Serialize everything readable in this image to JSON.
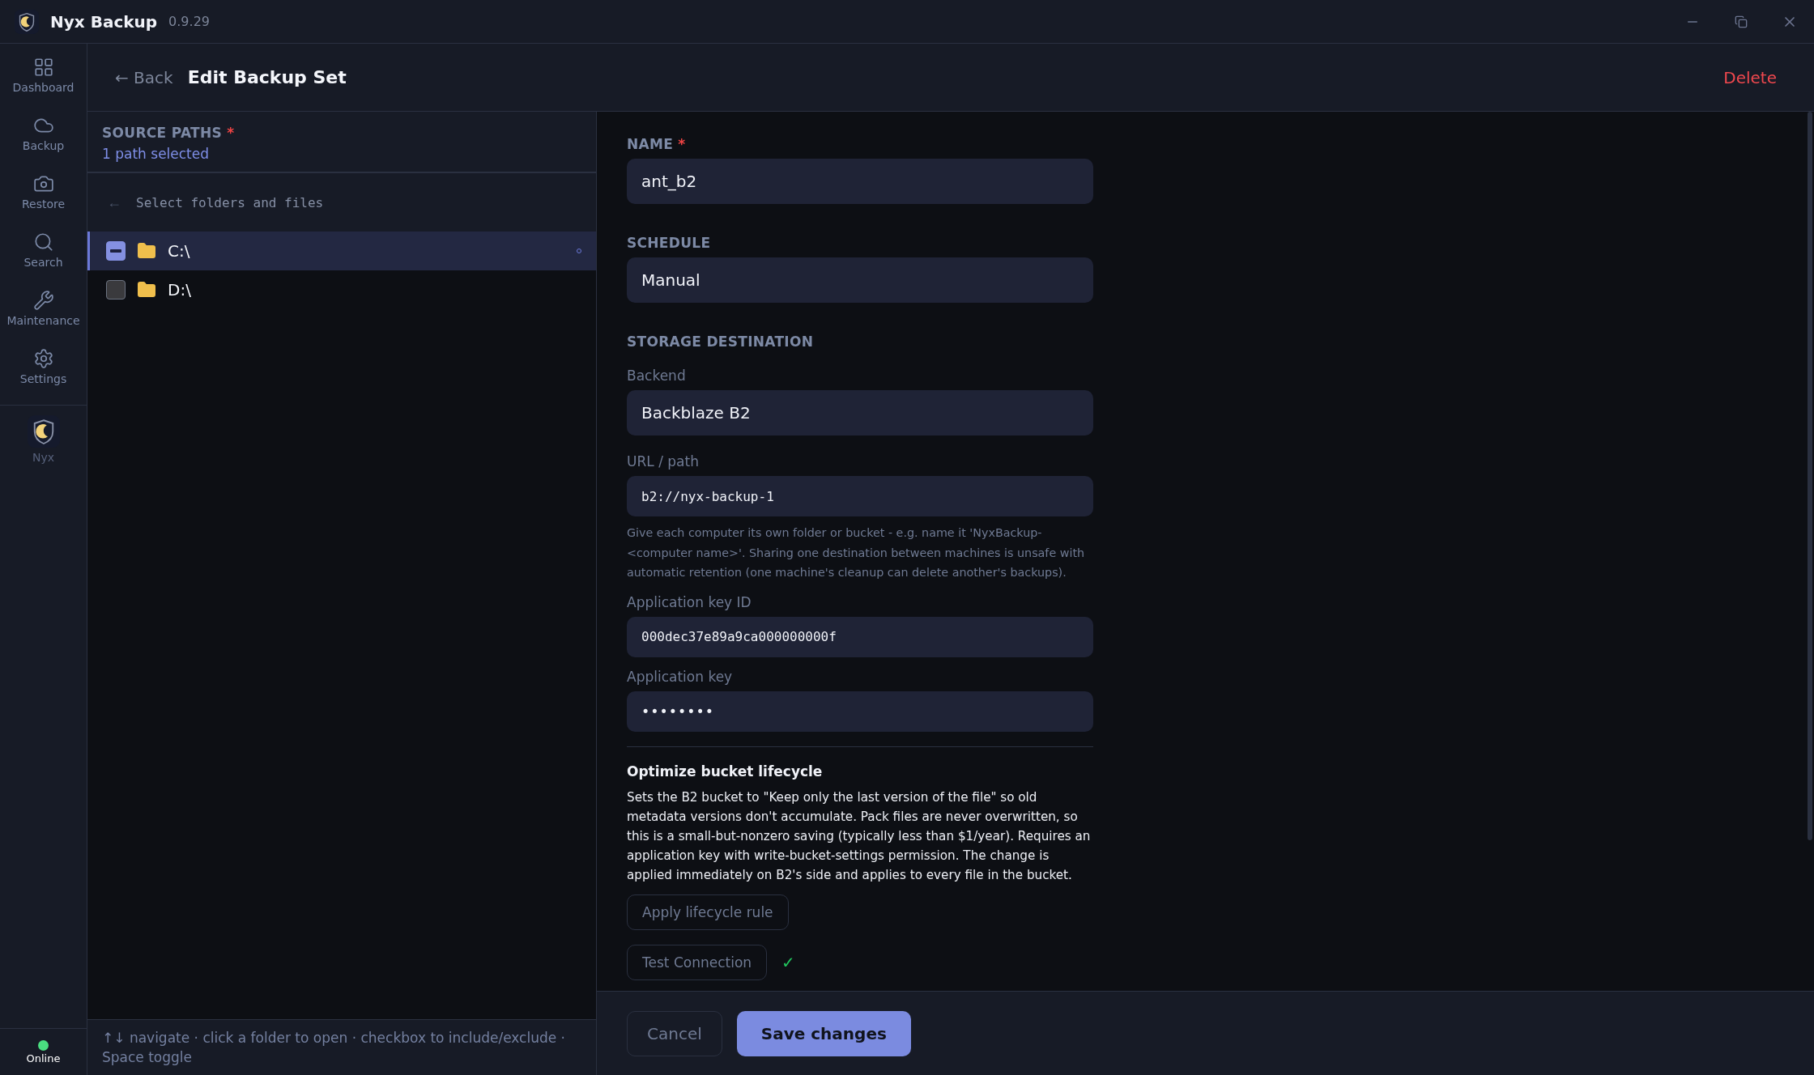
{
  "window": {
    "title": "Nyx Backup",
    "version": "0.9.29"
  },
  "sidebar": {
    "items": [
      {
        "kind": "dashboard",
        "label": "Dashboard"
      },
      {
        "kind": "backup",
        "label": "Backup"
      },
      {
        "kind": "restore",
        "label": "Restore"
      },
      {
        "kind": "search",
        "label": "Search"
      },
      {
        "kind": "maintenance",
        "label": "Maintenance"
      },
      {
        "kind": "settings",
        "label": "Settings"
      }
    ],
    "brand": {
      "label": "Nyx"
    },
    "status": {
      "label": "Online",
      "online": true
    }
  },
  "header": {
    "back": "← Back",
    "title": "Edit Backup Set",
    "delete": "Delete"
  },
  "source": {
    "label": "SOURCE PATHS",
    "required": "*",
    "summary": "1 path selected",
    "browser_back": "←",
    "browser_title": "Select folders and files",
    "items": [
      {
        "name": "C:\\",
        "partial": true,
        "selected": true
      },
      {
        "name": "D:\\",
        "partial": false,
        "selected": false
      }
    ],
    "help": "↑↓ navigate · click a folder to open · checkbox to include/exclude · Space toggle"
  },
  "form": {
    "name": {
      "label": "NAME",
      "required": "*",
      "value": "ant_b2"
    },
    "schedule": {
      "label": "SCHEDULE",
      "value": "Manual"
    },
    "storage": {
      "label": "STORAGE DESTINATION",
      "fields": [
        {
          "label": "Backend",
          "value": "Backblaze B2",
          "kind": "select"
        },
        {
          "label": "URL / path",
          "value": "b2://nyx-backup-1",
          "kind": "mono",
          "hint": "Give each computer its own folder or bucket - e.g. name it 'NyxBackup-<computer name>'. Sharing one destination between machines is unsafe with automatic retention (one machine's cleanup can delete another's backups)."
        },
        {
          "label": "Application key ID",
          "value": "000dec37e89a9ca000000000f",
          "kind": "mono"
        },
        {
          "label": "Application key",
          "value": "••••••••",
          "kind": "password"
        }
      ]
    },
    "lifecycle": {
      "title": "Optimize bucket lifecycle",
      "text": "Sets the B2 bucket to \"Keep only the last version of the file\" so old metadata versions don't accumulate. Pack files are never overwritten, so this is a small-but-nonzero saving (typically less than $1/year). Requires an application key with write-bucket-settings permission. The change is applied immediately on B2's side and applies to every file in the bucket.",
      "button": "Apply lifecycle rule"
    },
    "test": {
      "button": "Test Connection",
      "result": "✓"
    }
  },
  "footer": {
    "cancel": "Cancel",
    "save": "Save changes"
  }
}
